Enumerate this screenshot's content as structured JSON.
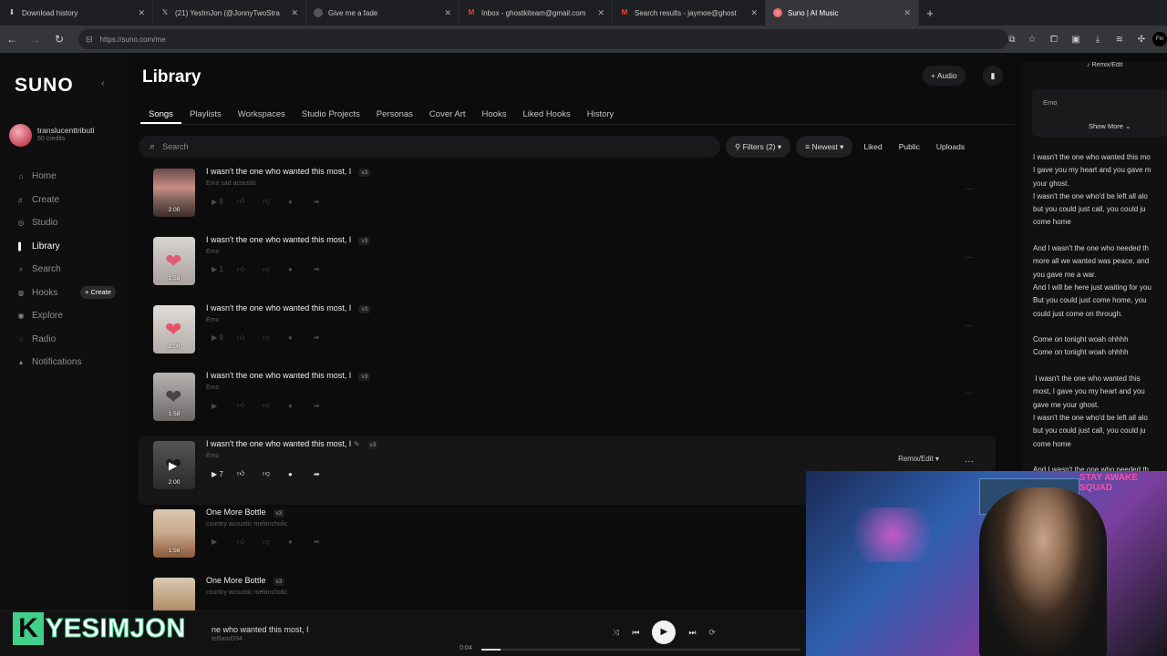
{
  "browser": {
    "tabs": [
      {
        "label": "Download history",
        "icon": "download-icon",
        "active": false
      },
      {
        "label": "(21) YesImJon (@JonnyTwoStra",
        "icon": "x-logo-icon",
        "active": false
      },
      {
        "label": "Give me a fade",
        "icon": "globe-icon",
        "active": false
      },
      {
        "label": "Inbox - ghostkiteam@gmail.com",
        "icon": "gmail-icon",
        "active": false
      },
      {
        "label": "Search results - jaymoe@ghost",
        "icon": "gmail-icon",
        "active": false
      },
      {
        "label": "Suno | AI Music",
        "icon": "suno-icon",
        "active": true
      }
    ],
    "new_tab": "+",
    "url": "https://suno.com/me",
    "profile": "Fin"
  },
  "sidebar": {
    "logo": "SUNO",
    "user": {
      "name": "translucenttributi",
      "credits": "50 credits"
    },
    "items": [
      {
        "label": "Home",
        "icon": "home-icon",
        "active": false
      },
      {
        "label": "Create",
        "icon": "music-note-icon",
        "active": false
      },
      {
        "label": "Studio",
        "icon": "studio-icon",
        "active": false
      },
      {
        "label": "Library",
        "icon": "library-icon",
        "active": true
      },
      {
        "label": "Search",
        "icon": "search-icon",
        "active": false
      },
      {
        "label": "Hooks",
        "icon": "hooks-icon",
        "active": false
      },
      {
        "label": "Explore",
        "icon": "explore-icon",
        "active": false
      },
      {
        "label": "Radio",
        "icon": "radio-icon",
        "active": false
      },
      {
        "label": "Notifications",
        "icon": "bell-icon",
        "active": false
      }
    ],
    "hooks_create": "+ Create"
  },
  "library": {
    "title": "Library",
    "audio_button": "+ Audio",
    "tabs": [
      "Songs",
      "Playlists",
      "Workspaces",
      "Studio Projects",
      "Personas",
      "Cover Art",
      "Hooks",
      "Liked Hooks",
      "History"
    ],
    "active_tab": "Songs",
    "search_placeholder": "Search",
    "filters": {
      "filters": "Filters (2)",
      "sort": "Newest",
      "liked": "Liked",
      "public": "Public",
      "uploads": "Uploads"
    }
  },
  "songs": [
    {
      "title": "I wasn't the one who wanted this most, I",
      "version": "v3",
      "style": "Emo sad acoustic",
      "duration": "2:00",
      "likes": "8",
      "highlight": false
    },
    {
      "title": "I wasn't the one who wanted this most, I",
      "version": "v3",
      "style": "Emo",
      "duration": "1:58",
      "likes": "1",
      "highlight": false
    },
    {
      "title": "I wasn't the one who wanted this most, I",
      "version": "v3",
      "style": "Emo",
      "duration": "2:00",
      "likes": "9",
      "highlight": false
    },
    {
      "title": "I wasn't the one who wanted this most, I",
      "version": "v3",
      "style": "Emo",
      "duration": "1:58",
      "likes": "",
      "highlight": false
    },
    {
      "title": "I wasn't the one who wanted this most, I",
      "version": "v3",
      "style": "Emo",
      "duration": "2:00",
      "likes": "7",
      "highlight": true,
      "remix": "Remix/Edit"
    },
    {
      "title": "One More Bottle",
      "version": "v3",
      "style": "country acoustic melancholic",
      "duration": "1:56",
      "likes": "",
      "highlight": false
    },
    {
      "title": "One More Bottle",
      "version": "v3",
      "style": "country acoustic melancholic",
      "duration": "",
      "likes": "",
      "highlight": false
    }
  ],
  "right_panel": {
    "remix": "Remix/Edit",
    "style_text": "Emo",
    "show_more": "Show More",
    "lyrics": "I wasn't the one who wanted this mo\nI gave you my heart and you gave m\nyour ghost.\nI wasn't the one who'd be left all alo\nbut you could just call, you could ju\ncome home\n\nAnd I wasn't the one who needed th\nmore all we wanted was peace, and\nyou gave me a war.\nAnd I will be here just waiting for you\nBut you could just come home, you\ncould just come on through.\n\nCome on tonight woah ohhhh\nCome on tonight woah ohhhh\n\n I wasn't the one who wanted this\nmost, I gave you my heart and you\ngave me your ghost.\nI wasn't the one who'd be left all alo\nbut you could just call, you could ju\ncome home\n\nAnd I wasn't the one who needed th"
  },
  "player": {
    "title": "ne who wanted this most, I",
    "artist": "teBand394",
    "time": "0:04",
    "progress": 0.06
  },
  "overlay": {
    "brand_k": "K",
    "brand_name": "YESIMJON",
    "webcam_sign": "STAY AWAKE SQUAD"
  },
  "colors": {
    "accent": "#3fd08a",
    "background": "#0c0c0d"
  }
}
